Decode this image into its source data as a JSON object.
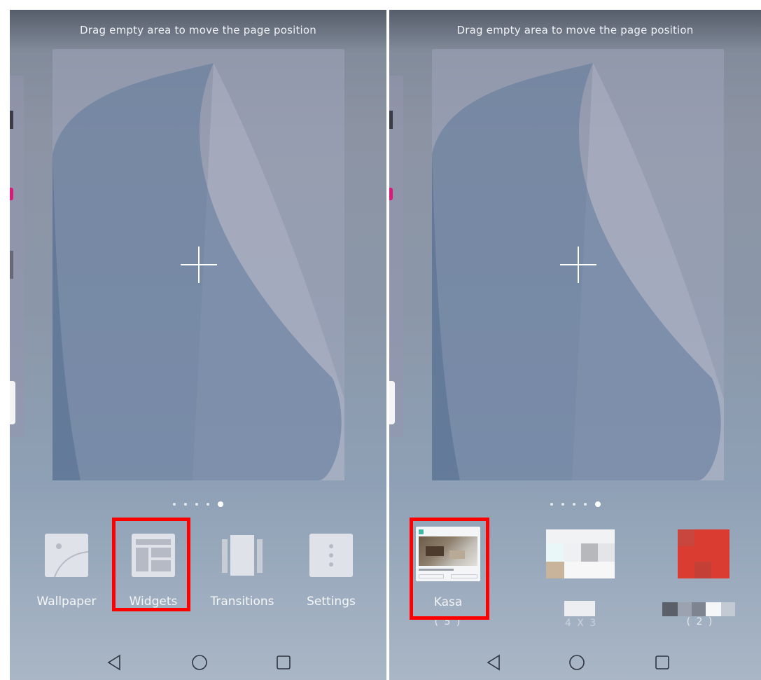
{
  "left_screen": {
    "hint": "Drag empty area to move the page position",
    "page_indicator": {
      "count": 5,
      "active_index": 4
    },
    "toolbar": {
      "wallpaper_label": "Wallpaper",
      "widgets_label": "Widgets",
      "transitions_label": "Transitions",
      "settings_label": "Settings"
    },
    "highlighted_item": "Widgets"
  },
  "right_screen": {
    "hint": "Drag empty area to move the page position",
    "page_indicator": {
      "count": 5,
      "active_index": 4
    },
    "widgets": [
      {
        "name": "Kasa",
        "count": "( 5 )"
      },
      {
        "name": "",
        "count": "4 X 3"
      },
      {
        "name": "",
        "count": "( 2 )"
      }
    ],
    "highlighted_item": "Kasa"
  },
  "nav_icons": [
    "back-icon",
    "home-icon",
    "recents-icon"
  ],
  "colors": {
    "highlight": "#ff0000",
    "wallpaper": "#8b97a9",
    "tile": "#dfe2e8"
  }
}
